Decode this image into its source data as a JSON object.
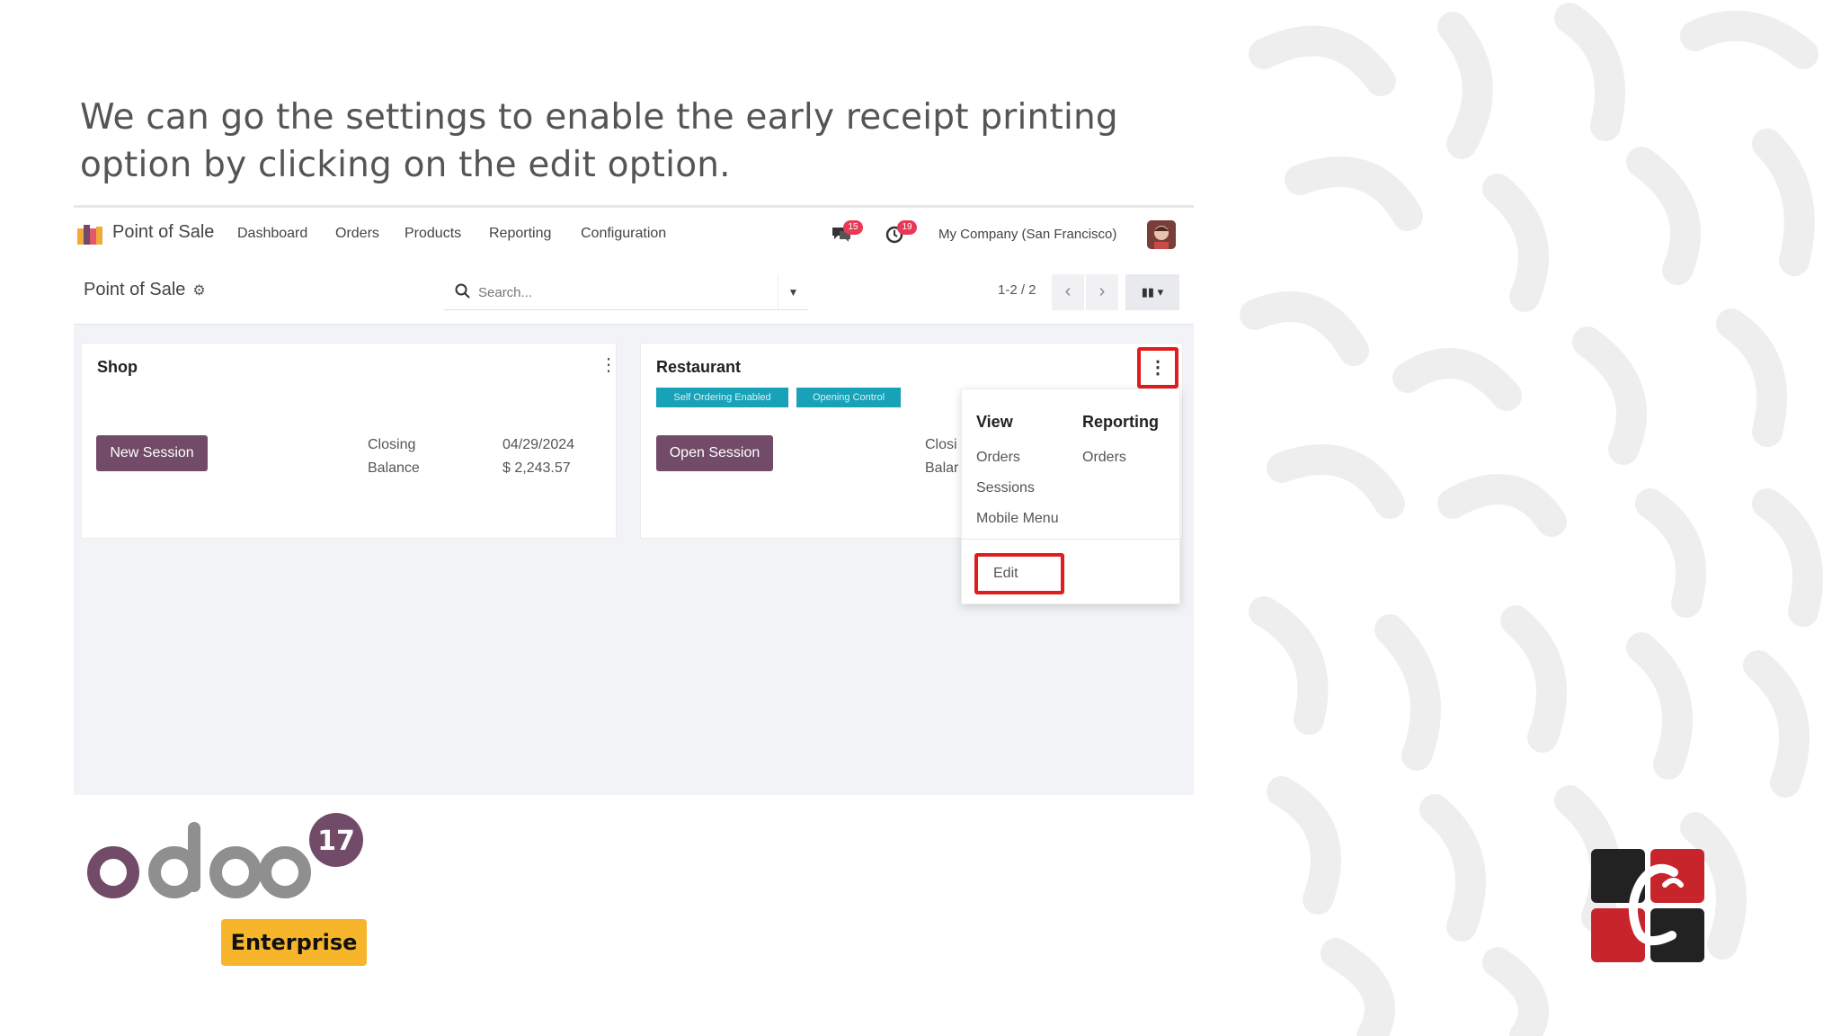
{
  "heading": "We can go the settings to enable the early receipt printing option by clicking on the edit option.",
  "navbar": {
    "app_name": "Point of Sale",
    "menus": [
      "Dashboard",
      "Orders",
      "Products",
      "Reporting",
      "Configuration"
    ],
    "messages_badge": "15",
    "activities_badge": "19",
    "company": "My Company (San Francisco)"
  },
  "controlbar": {
    "breadcrumb": "Point of Sale",
    "search_placeholder": "Search...",
    "pager": "1-2 / 2"
  },
  "cards": [
    {
      "title": "Shop",
      "button": "New Session",
      "closing_label": "Closing",
      "balance_label": "Balance",
      "closing_date": "04/29/2024",
      "balance_value": "$ 2,243.57"
    },
    {
      "title": "Restaurant",
      "button": "Open Session",
      "tags": [
        "Self Ordering Enabled",
        "Opening Control"
      ],
      "closing_label_partial": "Closi",
      "balance_label_partial": "Balar"
    }
  ],
  "dropdown": {
    "view_header": "View",
    "reporting_header": "Reporting",
    "view_items": [
      "Orders",
      "Sessions",
      "Mobile Menu"
    ],
    "reporting_items": [
      "Orders"
    ],
    "edit_label": "Edit"
  },
  "branding": {
    "version": "17",
    "edition": "Enterprise",
    "accent": "#714b67",
    "highlight": "#e21c1c",
    "tag_color": "#17a2b8"
  }
}
